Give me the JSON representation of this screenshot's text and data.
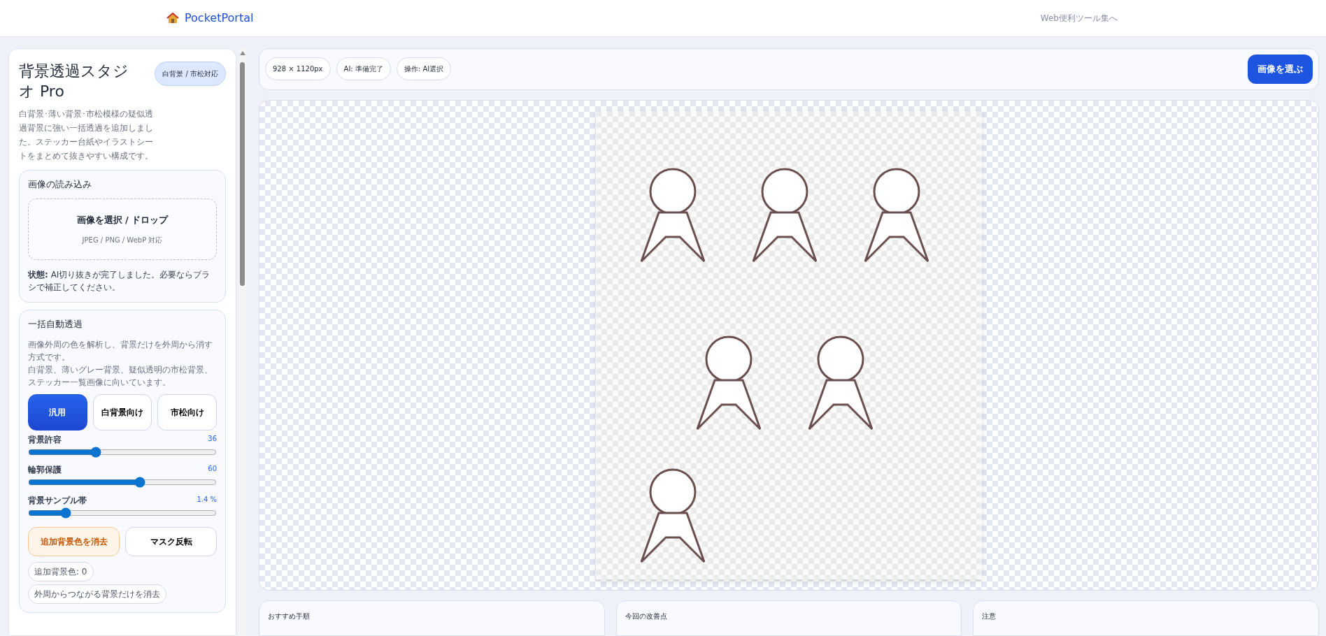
{
  "header": {
    "brand": "PocketPortal",
    "link": "Web便利ツール集へ"
  },
  "sidebar": {
    "title": "背景透過スタジオ Pro",
    "badge": "白背景 / 市松対応",
    "description": "白背景･薄い背景･市松模様の疑似透過背景に強い一括透過を追加しました。ステッカー台紙やイラストシートをまとめて抜きやすい構成です。",
    "load_card": {
      "title": "画像の読み込み",
      "dropzone_title": "画像を選択 / ドロップ",
      "dropzone_hint": "JPEG / PNG / WebP 対応",
      "status": "**状態:** AI切り抜きが完了しました。必要ならブラシで補正してください。"
    },
    "auto_card": {
      "title": "一括自動透過",
      "description": [
        "画像外周の色を解析し、背景だけを外周から消す方式です。",
        "白背景、薄いグレー背景、疑似透明の市松背景、ステッカー一覧画像に向いています。"
      ],
      "presets": [
        {
          "label": "汎用",
          "selected": true
        },
        {
          "label": "白背景向け",
          "selected": false
        },
        {
          "label": "市松向け",
          "selected": false
        }
      ],
      "sliders": [
        {
          "label": "背景許容",
          "reading": "36",
          "level": 0.35
        },
        {
          "label": "輪郭保護",
          "reading": "60",
          "level": 0.6
        },
        {
          "label": "背景サンプル帯",
          "reading": "1.4 %",
          "level": 0.18
        }
      ],
      "buttons": [
        {
          "label": "追加背景色を消去",
          "kind": "warning"
        },
        {
          "label": "マスク反転",
          "kind": "default"
        }
      ],
      "chips": [
        "追加背景色: 0",
        "外周からつながる背景だけを消去"
      ]
    }
  },
  "toolbar": {
    "chips": [
      "928 × 1120px",
      "AI: 準備完了",
      "操作: AI選択"
    ],
    "button": "画像を選ぶ"
  },
  "info_cards": [
    "おすすめ手順",
    "今回の改善点",
    "注意"
  ]
}
